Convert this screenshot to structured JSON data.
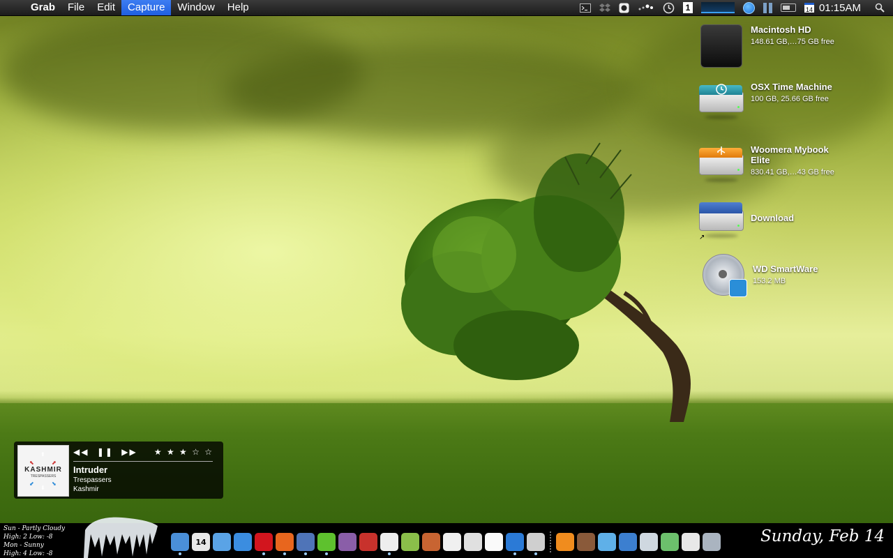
{
  "menubar": {
    "apple_icon": "apple-icon",
    "app_name": "Grab",
    "menus": [
      "File",
      "Edit",
      "Capture",
      "Window",
      "Help"
    ],
    "active_menu": "Capture",
    "status_icons": [
      "terminal-icon",
      "dropbox-icon",
      "camera-icon",
      "dots-icon",
      "time-machine-icon"
    ],
    "desktop_number": "1",
    "calendar_day": "14",
    "clock": "01:15AM",
    "search_icon": "spotlight-icon"
  },
  "desktop_icons": [
    {
      "name": "Macintosh HD",
      "sub": "148.61 GB,…75 GB free",
      "icon": "hard-drive-icon"
    },
    {
      "name": "OSX Time Machine",
      "sub": "100 GB, 25.66 GB free",
      "icon": "time-machine-drive-icon"
    },
    {
      "name": "Woomera Mybook Elite",
      "sub": "830.41 GB,…43 GB free",
      "icon": "usb-drive-icon"
    },
    {
      "name": "Download",
      "sub": "",
      "icon": "network-drive-icon"
    },
    {
      "name": "WD SmartWare",
      "sub": "153.2 MB",
      "icon": "disc-icon"
    }
  ],
  "player": {
    "album_art_title": "KASHMIR",
    "album_art_subtitle": "TRESPASSERS",
    "track": "Intruder",
    "album": "Trespassers",
    "artist": "Kashmir",
    "rating": 3,
    "stars": "★ ★ ★ ☆ ☆",
    "prev": "◀◀",
    "pause": "❚❚",
    "next": "▶▶"
  },
  "weather": {
    "line1": "Sun - Partly Cloudy",
    "line2": "High: 2 Low: -8",
    "line3": "Mon - Sunny",
    "line4": "High: 4 Low: -8"
  },
  "dock": {
    "calendar_day": "14",
    "apps": [
      {
        "name": "finder",
        "color": "#4a8fd8",
        "running": true
      },
      {
        "name": "ical",
        "color": "#e8e8e8",
        "running": false
      },
      {
        "name": "mail",
        "color": "#5aa3e6",
        "running": false
      },
      {
        "name": "safari",
        "color": "#3b8de0",
        "running": false
      },
      {
        "name": "opera",
        "color": "#d2151e",
        "running": true
      },
      {
        "name": "firefox",
        "color": "#e8661e",
        "running": true
      },
      {
        "name": "preview",
        "color": "#4f74b8",
        "running": true
      },
      {
        "name": "adium",
        "color": "#5ec12e",
        "running": true
      },
      {
        "name": "tor",
        "color": "#8a5ea8",
        "running": false
      },
      {
        "name": "lighthouse",
        "color": "#c8322c",
        "running": false
      },
      {
        "name": "camino",
        "color": "#eeeeee",
        "running": true
      },
      {
        "name": "coda",
        "color": "#8bbf4a",
        "running": false
      },
      {
        "name": "photo-booth",
        "color": "#c86432",
        "running": false
      },
      {
        "name": "picasa",
        "color": "#f0f0f0",
        "running": false
      },
      {
        "name": "keepassx",
        "color": "#e0e0e0",
        "running": false
      },
      {
        "name": "textedit",
        "color": "#fafafa",
        "running": false
      },
      {
        "name": "quicktime",
        "color": "#2b7ad6",
        "running": true
      },
      {
        "name": "grab",
        "color": "#cfcfcf",
        "running": true
      },
      {
        "name": "vlc",
        "color": "#f08c1e",
        "running": false
      },
      {
        "name": "cyberduck",
        "color": "#8a5a3a",
        "running": false
      },
      {
        "name": "twitterrific",
        "color": "#5fb0e8",
        "running": false
      },
      {
        "name": "ftp",
        "color": "#3c7fd0",
        "running": false
      },
      {
        "name": "home-folder",
        "color": "#cfd8e0",
        "running": false
      },
      {
        "name": "downloads-folder",
        "color": "#6cc06c",
        "running": false
      },
      {
        "name": "documents",
        "color": "#e8e8e8",
        "running": false
      },
      {
        "name": "trash",
        "color": "#aab4c0",
        "running": false
      }
    ]
  },
  "date_text": "Sunday, Feb 14"
}
